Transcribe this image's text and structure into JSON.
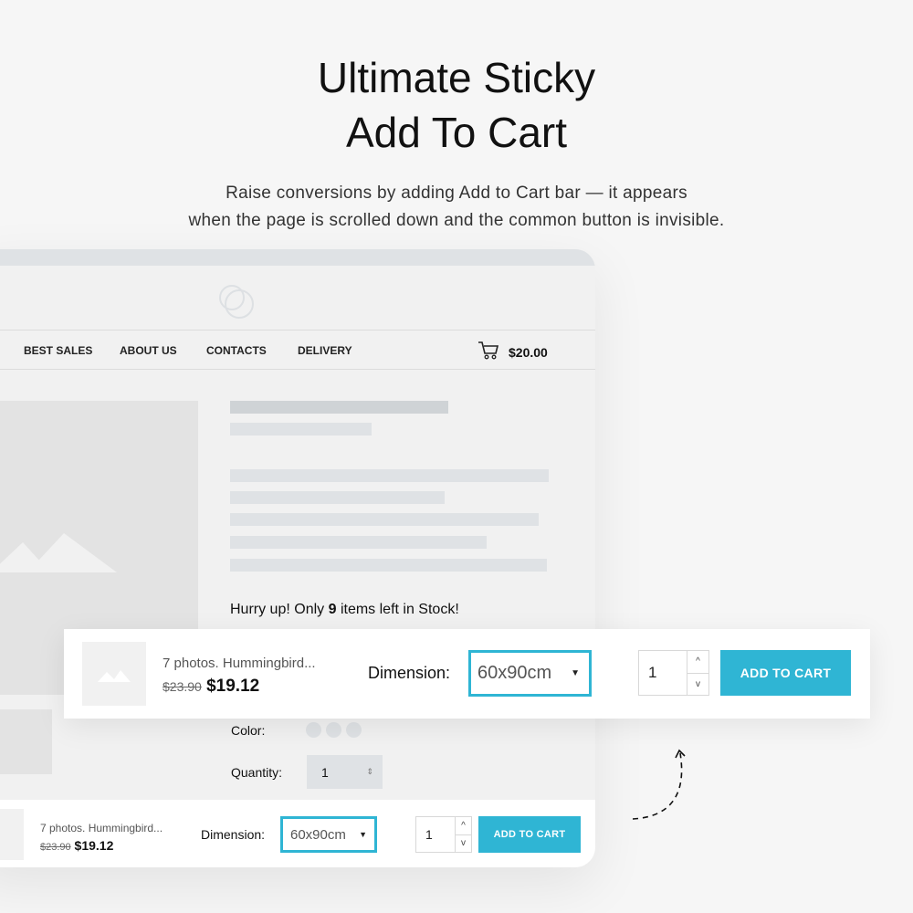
{
  "headline": {
    "line1": "Ultimate Sticky",
    "line2": "Add To Cart",
    "sub1": "Raise conversions by adding Add to Cart bar — it appears",
    "sub2": "when the page is scrolled down and the common button is invisible."
  },
  "nav": {
    "items": [
      "BEST SALES",
      "ABOUT US",
      "CONTACTS",
      "DELIVERY"
    ],
    "cart_total": "$20.00"
  },
  "product": {
    "stock_pre": "Hurry up! Only ",
    "stock_count": "9",
    "stock_post": " items left in Stock!",
    "color_label": "Color:",
    "quantity_label": "Quantity:",
    "quantity": "1"
  },
  "sticky": {
    "name": "7 photos. Hummingbird...",
    "old_price": "$23.90",
    "price": "$19.12",
    "dimension_label": "Dimension:",
    "dimension": "60x90cm",
    "qty": "1",
    "add_label": "ADD TO CART"
  },
  "colors": {
    "accent": "#2fb5d4"
  }
}
